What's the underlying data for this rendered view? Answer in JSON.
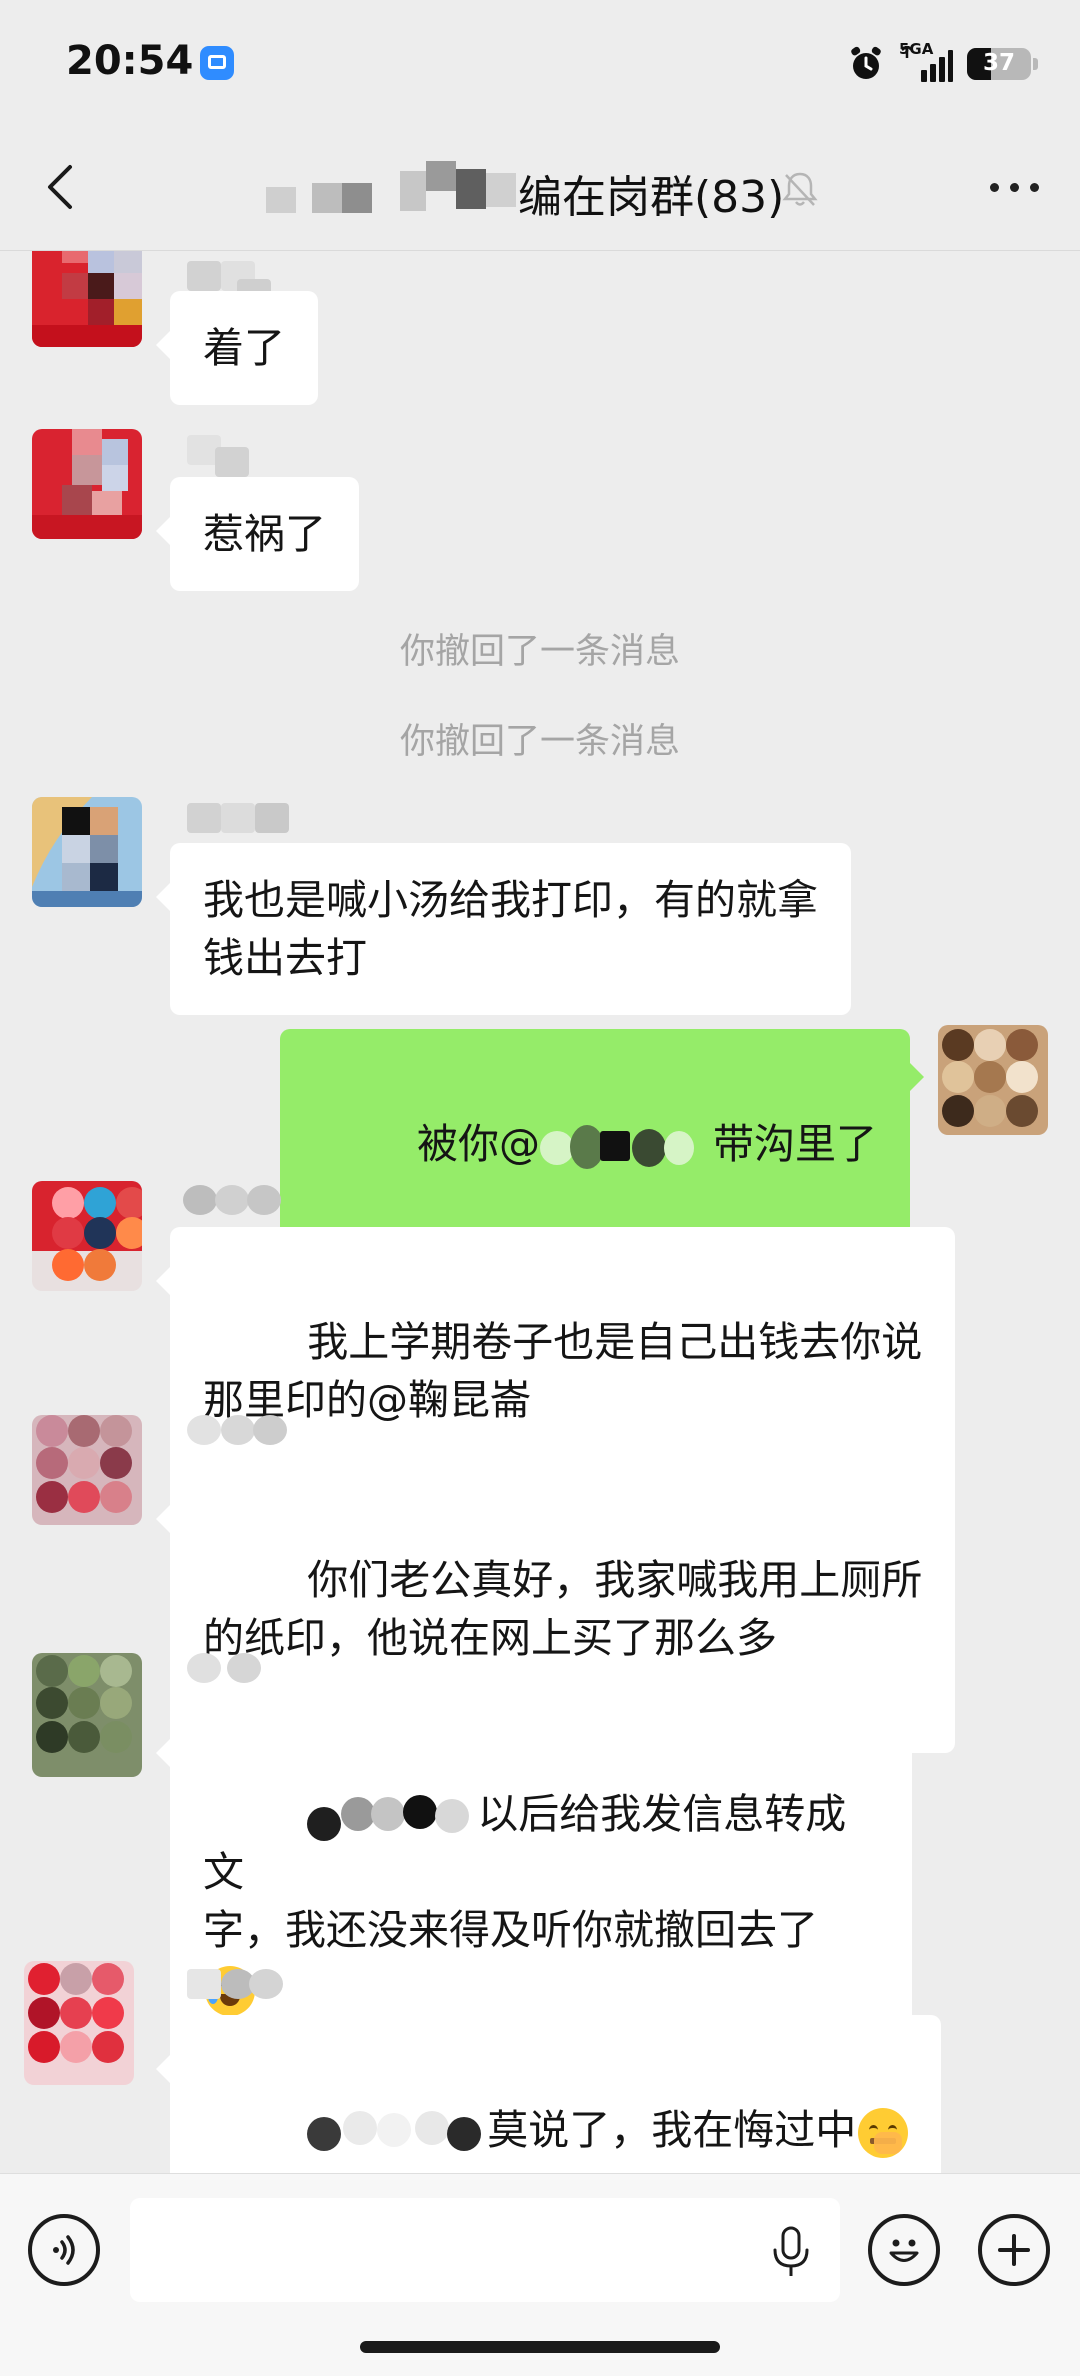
{
  "status_bar": {
    "time": "20:54",
    "network": "5GA",
    "battery": "37",
    "battery_level": 0.37
  },
  "header": {
    "title_visible": "编在岗群(83)",
    "back_icon": "chevron-left-icon",
    "mute_icon": "bell-off-icon",
    "more_icon": "more-dots-icon"
  },
  "messages": [
    {
      "type": "incoming",
      "text": "着了"
    },
    {
      "type": "incoming",
      "text": "惹祸了"
    },
    {
      "type": "system",
      "text": "你撤回了一条消息"
    },
    {
      "type": "system",
      "text": "你撤回了一条消息"
    },
    {
      "type": "incoming",
      "text": "我也是喊小汤给我打印，有的就拿\n钱出去打"
    },
    {
      "type": "outgoing",
      "text_before": "被你@",
      "text_after": " 带沟里了"
    },
    {
      "type": "incoming",
      "text": "我上学期卷子也是自己出钱去你说\n那里印的@鞠昆崙"
    },
    {
      "type": "incoming",
      "text": "你们老公真好，我家喊我用上厕所\n的纸印，他说在网上买了那么多"
    },
    {
      "type": "incoming",
      "text_line1": "以后给我发信息转成文",
      "text_rest": "字，我还没来得及听你就撤回去了",
      "emoji": "crying-laughing-emoji"
    },
    {
      "type": "incoming",
      "text": "莫说了，我在悔过中",
      "emoji": "zipper-mouth-emoji"
    }
  ],
  "input_bar": {
    "placeholder": "",
    "voice_icon": "voice-icon",
    "mic_icon": "microphone-icon",
    "emoji_icon": "emoji-icon",
    "plus_icon": "plus-icon"
  },
  "colors": {
    "background": "#ededed",
    "incoming_bubble": "#ffffff",
    "outgoing_bubble": "#95ec69",
    "system_text": "#a5a5a5"
  }
}
